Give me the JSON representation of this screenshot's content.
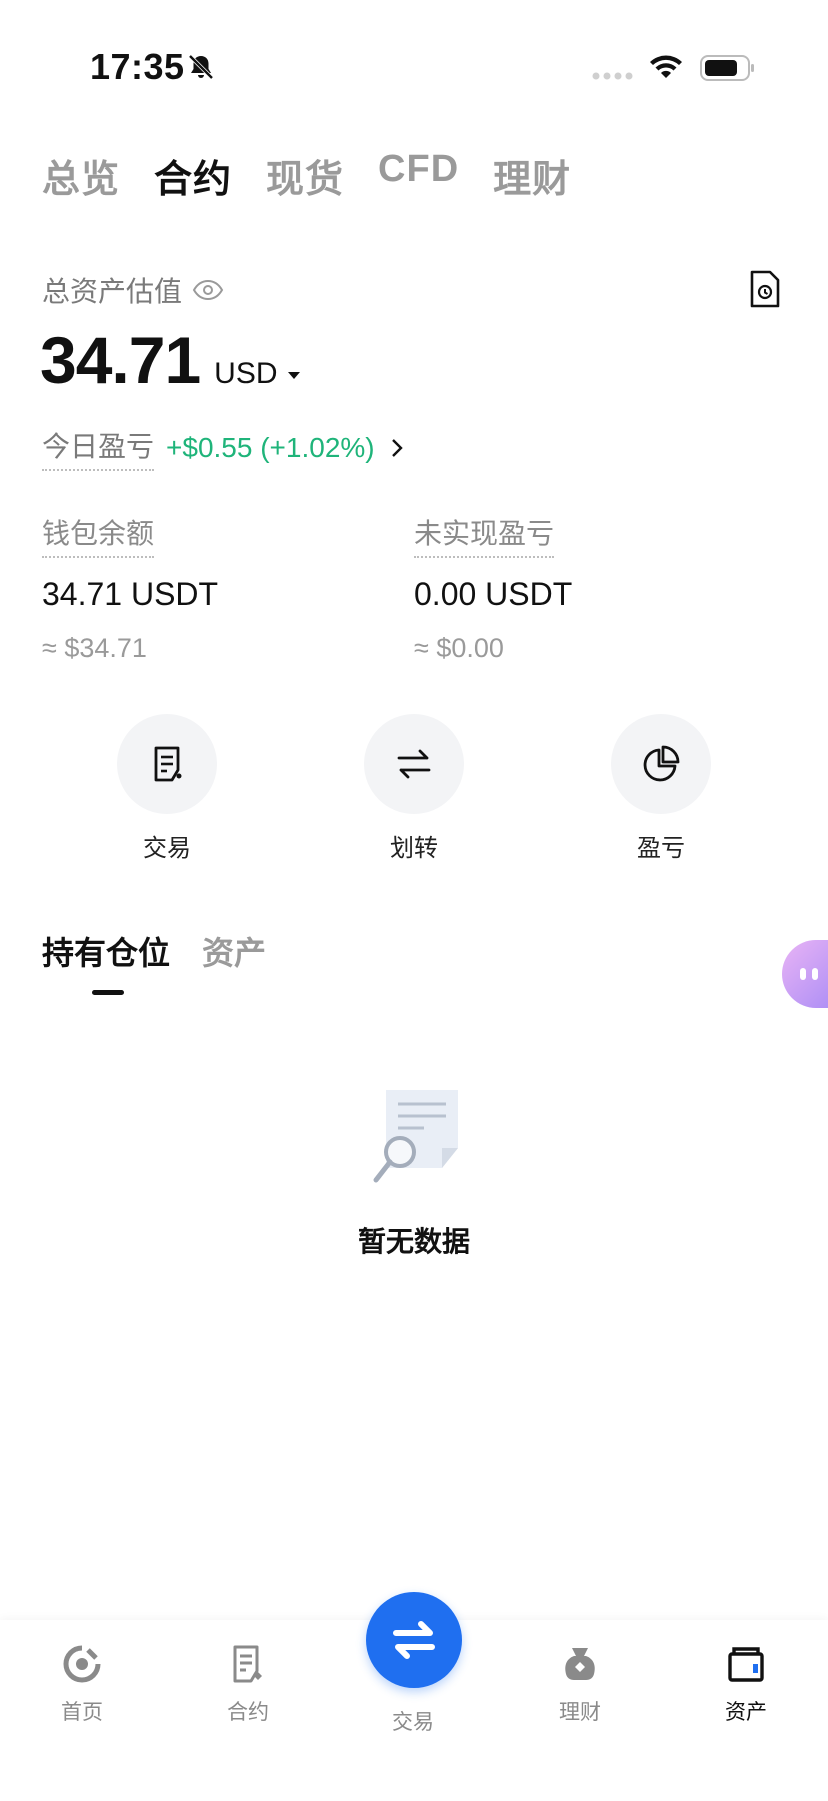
{
  "status_bar": {
    "time": "17:35"
  },
  "top_tabs": [
    {
      "label": "总览",
      "active": false
    },
    {
      "label": "合约",
      "active": true
    },
    {
      "label": "现货",
      "active": false
    },
    {
      "label": "CFD",
      "active": false
    },
    {
      "label": "理财",
      "active": false
    }
  ],
  "summary": {
    "total_label": "总资产估值",
    "total_value": "34.71",
    "currency": "USD",
    "pnl_label": "今日盈亏",
    "pnl_value": "+$0.55 (+1.02%)"
  },
  "balances": {
    "wallet": {
      "label": "钱包余额",
      "value": "34.71 USDT",
      "approx": "≈ $34.71"
    },
    "unrealized": {
      "label": "未实现盈亏",
      "value": "0.00 USDT",
      "approx": "≈ $0.00"
    }
  },
  "actions": [
    {
      "label": "交易",
      "icon": "order-icon"
    },
    {
      "label": "划转",
      "icon": "transfer-icon"
    },
    {
      "label": "盈亏",
      "icon": "pie-chart-icon"
    }
  ],
  "section_tabs": [
    {
      "label": "持有仓位",
      "active": true
    },
    {
      "label": "资产",
      "active": false
    }
  ],
  "empty_state": {
    "text": "暂无数据"
  },
  "bottom_nav": [
    {
      "label": "首页",
      "icon": "home-icon",
      "active": false
    },
    {
      "label": "合约",
      "icon": "contract-icon",
      "active": false
    },
    {
      "label": "交易",
      "icon": "trade-icon",
      "active": false
    },
    {
      "label": "理财",
      "icon": "finance-icon",
      "active": false
    },
    {
      "label": "资产",
      "icon": "wallet-icon",
      "active": true
    }
  ],
  "colors": {
    "accent": "#1f6ff0",
    "profit": "#1fb47a"
  }
}
